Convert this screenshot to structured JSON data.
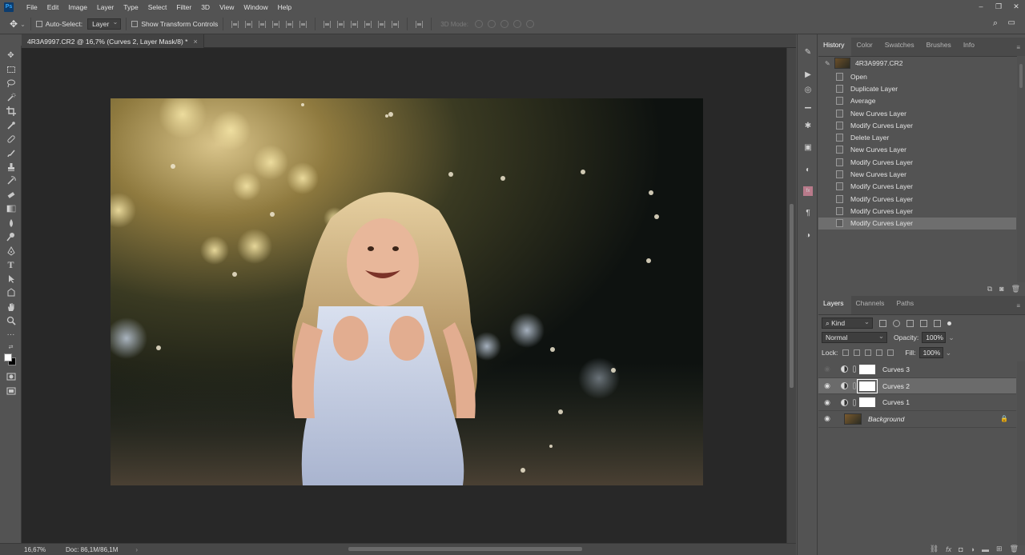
{
  "app": {
    "logo": "Ps",
    "menu": [
      "File",
      "Edit",
      "Image",
      "Layer",
      "Type",
      "Select",
      "Filter",
      "3D",
      "View",
      "Window",
      "Help"
    ],
    "window_controls": [
      "–",
      "❐",
      "✕"
    ]
  },
  "options_bar": {
    "auto_select_label": "Auto-Select:",
    "auto_select_value": "Layer",
    "show_transform_label": "Show Transform Controls",
    "mode_3d_label": "3D Mode:"
  },
  "document": {
    "tab_title": "4R3A9997.CR2 @ 16,7% (Curves 2, Layer Mask/8) *",
    "tab_close": "×"
  },
  "status_bar": {
    "zoom": "16,67%",
    "doc_info": "Doc: 86,1M/86,1M",
    "arrow": "›"
  },
  "history_panel": {
    "tabs": [
      "History",
      "Color",
      "Swatches",
      "Brushes",
      "Info"
    ],
    "active_tab": "History",
    "snapshot_name": "4R3A9997.CR2",
    "states": [
      "Open",
      "Duplicate Layer",
      "Average",
      "New Curves Layer",
      "Modify Curves Layer",
      "Delete Layer",
      "New Curves Layer",
      "Modify Curves Layer",
      "New Curves Layer",
      "Modify Curves Layer",
      "Modify Curves Layer",
      "Modify Curves Layer",
      "Modify Curves Layer"
    ],
    "active_state_index": 12
  },
  "layers_panel": {
    "tabs": [
      "Layers",
      "Channels",
      "Paths"
    ],
    "active_tab": "Layers",
    "filter_kind": "Kind",
    "blend_mode": "Normal",
    "opacity_label": "Opacity:",
    "opacity_value": "100%",
    "lock_label": "Lock:",
    "fill_label": "Fill:",
    "fill_value": "100%",
    "layers": [
      {
        "name": "Curves 3",
        "visible": false,
        "type": "curves",
        "active": false
      },
      {
        "name": "Curves 2",
        "visible": true,
        "type": "curves",
        "active": true
      },
      {
        "name": "Curves 1",
        "visible": true,
        "type": "curves",
        "active": false
      },
      {
        "name": "Background",
        "visible": true,
        "type": "background",
        "active": false,
        "locked": true
      }
    ]
  },
  "colors": {
    "ui_bg": "#535353",
    "canvas_bg": "#282828",
    "active_row": "#6e6e6e",
    "accent_ps": "#31a8ff"
  },
  "icons": {
    "tools": [
      "move-icon",
      "marquee-icon",
      "lasso-icon",
      "quick-select-icon",
      "crop-icon",
      "eyedropper-icon",
      "healing-icon",
      "brush-icon",
      "stamp-icon",
      "history-brush-icon",
      "eraser-icon",
      "gradient-icon",
      "blur-icon",
      "dodge-icon",
      "pen-icon",
      "type-icon",
      "path-select-icon",
      "shape-icon",
      "hand-icon",
      "zoom-icon",
      "more-tools-icon",
      "swap-colors-icon",
      "foreground-color-icon",
      "quick-mask-icon",
      "screen-mode-icon"
    ],
    "strip": [
      "brush-preset-icon",
      "play-icon",
      "3d-icon",
      "histogram-icon",
      "adjustments-icon",
      "image-icon",
      "navigator-icon",
      "styles-icon",
      "paragraph-icon",
      "layer-comps-icon"
    ]
  }
}
